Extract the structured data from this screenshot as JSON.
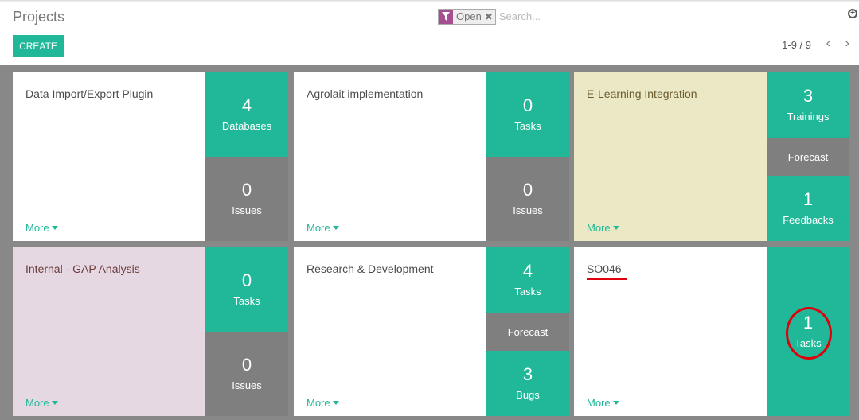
{
  "control_panel": {
    "title": "Projects",
    "create_label": "CREATE",
    "search": {
      "facet_icon": "filter-icon",
      "facet_label": "Open",
      "facet_remove_icon": "close-icon",
      "placeholder": "Search...",
      "expand_icon": "plus-circle-icon"
    },
    "pager": {
      "value": "1-9 / 9",
      "prev_icon": "chevron-left-icon",
      "next_icon": "chevron-right-icon",
      "prev_glyph": "‹",
      "next_glyph": "›"
    }
  },
  "more_label": "More",
  "colors": {
    "accent": "#21b799",
    "stat_gray": "#7f7f7f",
    "kanban_bg": "#888888",
    "facet_purple": "#a64f90",
    "card_yellow": "#ebe9c5",
    "card_pink": "#e6d8e2",
    "annotation_red": "#e0000b"
  },
  "projects": [
    {
      "name": "Data Import/Export Plugin",
      "stats": [
        {
          "value": "4",
          "label": "Databases"
        },
        {
          "value": "0",
          "label": "Issues"
        }
      ]
    },
    {
      "name": "Agrolait implementation",
      "stats": [
        {
          "value": "0",
          "label": "Tasks"
        },
        {
          "value": "0",
          "label": "Issues"
        }
      ]
    },
    {
      "name": "E-Learning Integration",
      "stats": [
        {
          "value": "3",
          "label": "Trainings"
        },
        {
          "value": "1",
          "label": "Feedbacks"
        }
      ],
      "forecast": "Forecast"
    },
    {
      "name": "Internal - GAP Analysis",
      "stats": [
        {
          "value": "0",
          "label": "Tasks"
        },
        {
          "value": "0",
          "label": "Issues"
        }
      ]
    },
    {
      "name": "Research & Development",
      "stats": [
        {
          "value": "4",
          "label": "Tasks"
        },
        {
          "value": "3",
          "label": "Bugs"
        }
      ],
      "forecast": "Forecast"
    },
    {
      "name": "SO046",
      "stats": [
        {
          "value": "1",
          "label": "Tasks"
        }
      ]
    }
  ]
}
